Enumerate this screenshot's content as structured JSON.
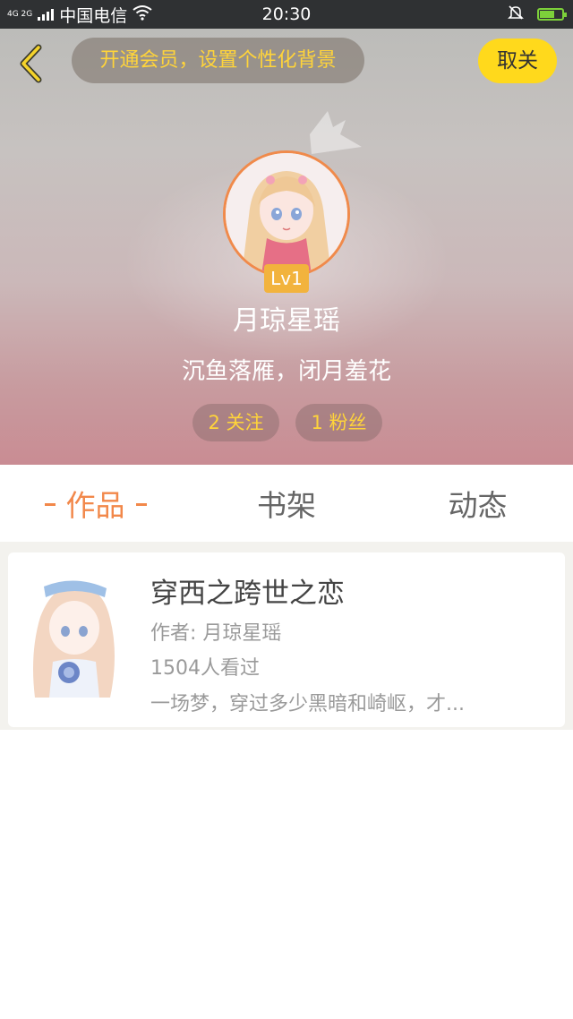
{
  "status_bar": {
    "network": "4G 2G",
    "carrier": "中国电信",
    "time": "20:30",
    "battery_level": 0.65,
    "icons": [
      "wifi-icon",
      "bell-muted-icon",
      "battery-icon"
    ]
  },
  "header": {
    "vip_promo": "开通会员，设置个性化背景",
    "unfollow_label": "取关",
    "level": "Lv1",
    "nickname": "月琼星瑶",
    "signature": "沉鱼落雁，闭月羞花",
    "following": "2 关注",
    "fans": "1 粉丝"
  },
  "tabs": [
    {
      "label": "作品",
      "active": true
    },
    {
      "label": "书架",
      "active": false
    },
    {
      "label": "动态",
      "active": false
    }
  ],
  "works": [
    {
      "title": "穿西之跨世之恋",
      "author": "作者: 月琼星瑶",
      "reads": "1504人看过",
      "description": "一场梦，穿过多少黑暗和崎岖，才..."
    }
  ],
  "colors": {
    "accent_orange": "#f2884a",
    "vip_yellow": "#ffd43a",
    "unfollow_yellow": "#ffd91c",
    "level_badge": "#f2b33d"
  }
}
